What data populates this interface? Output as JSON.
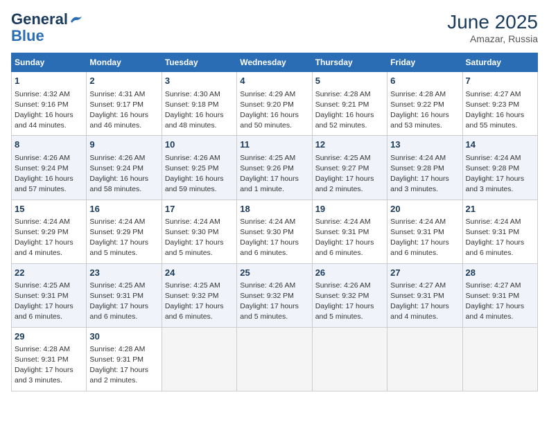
{
  "header": {
    "logo_line1": "General",
    "logo_line2": "Blue",
    "month_year": "June 2025",
    "location": "Amazar, Russia"
  },
  "days_of_week": [
    "Sunday",
    "Monday",
    "Tuesday",
    "Wednesday",
    "Thursday",
    "Friday",
    "Saturday"
  ],
  "weeks": [
    [
      {
        "day": "1",
        "sunrise": "4:32 AM",
        "sunset": "9:16 PM",
        "daylight": "16 hours and 44 minutes."
      },
      {
        "day": "2",
        "sunrise": "4:31 AM",
        "sunset": "9:17 PM",
        "daylight": "16 hours and 46 minutes."
      },
      {
        "day": "3",
        "sunrise": "4:30 AM",
        "sunset": "9:18 PM",
        "daylight": "16 hours and 48 minutes."
      },
      {
        "day": "4",
        "sunrise": "4:29 AM",
        "sunset": "9:20 PM",
        "daylight": "16 hours and 50 minutes."
      },
      {
        "day": "5",
        "sunrise": "4:28 AM",
        "sunset": "9:21 PM",
        "daylight": "16 hours and 52 minutes."
      },
      {
        "day": "6",
        "sunrise": "4:28 AM",
        "sunset": "9:22 PM",
        "daylight": "16 hours and 53 minutes."
      },
      {
        "day": "7",
        "sunrise": "4:27 AM",
        "sunset": "9:23 PM",
        "daylight": "16 hours and 55 minutes."
      }
    ],
    [
      {
        "day": "8",
        "sunrise": "4:26 AM",
        "sunset": "9:24 PM",
        "daylight": "16 hours and 57 minutes."
      },
      {
        "day": "9",
        "sunrise": "4:26 AM",
        "sunset": "9:24 PM",
        "daylight": "16 hours and 58 minutes."
      },
      {
        "day": "10",
        "sunrise": "4:26 AM",
        "sunset": "9:25 PM",
        "daylight": "16 hours and 59 minutes."
      },
      {
        "day": "11",
        "sunrise": "4:25 AM",
        "sunset": "9:26 PM",
        "daylight": "17 hours and 1 minute."
      },
      {
        "day": "12",
        "sunrise": "4:25 AM",
        "sunset": "9:27 PM",
        "daylight": "17 hours and 2 minutes."
      },
      {
        "day": "13",
        "sunrise": "4:24 AM",
        "sunset": "9:28 PM",
        "daylight": "17 hours and 3 minutes."
      },
      {
        "day": "14",
        "sunrise": "4:24 AM",
        "sunset": "9:28 PM",
        "daylight": "17 hours and 3 minutes."
      }
    ],
    [
      {
        "day": "15",
        "sunrise": "4:24 AM",
        "sunset": "9:29 PM",
        "daylight": "17 hours and 4 minutes."
      },
      {
        "day": "16",
        "sunrise": "4:24 AM",
        "sunset": "9:29 PM",
        "daylight": "17 hours and 5 minutes."
      },
      {
        "day": "17",
        "sunrise": "4:24 AM",
        "sunset": "9:30 PM",
        "daylight": "17 hours and 5 minutes."
      },
      {
        "day": "18",
        "sunrise": "4:24 AM",
        "sunset": "9:30 PM",
        "daylight": "17 hours and 6 minutes."
      },
      {
        "day": "19",
        "sunrise": "4:24 AM",
        "sunset": "9:31 PM",
        "daylight": "17 hours and 6 minutes."
      },
      {
        "day": "20",
        "sunrise": "4:24 AM",
        "sunset": "9:31 PM",
        "daylight": "17 hours and 6 minutes."
      },
      {
        "day": "21",
        "sunrise": "4:24 AM",
        "sunset": "9:31 PM",
        "daylight": "17 hours and 6 minutes."
      }
    ],
    [
      {
        "day": "22",
        "sunrise": "4:25 AM",
        "sunset": "9:31 PM",
        "daylight": "17 hours and 6 minutes."
      },
      {
        "day": "23",
        "sunrise": "4:25 AM",
        "sunset": "9:31 PM",
        "daylight": "17 hours and 6 minutes."
      },
      {
        "day": "24",
        "sunrise": "4:25 AM",
        "sunset": "9:32 PM",
        "daylight": "17 hours and 6 minutes."
      },
      {
        "day": "25",
        "sunrise": "4:26 AM",
        "sunset": "9:32 PM",
        "daylight": "17 hours and 5 minutes."
      },
      {
        "day": "26",
        "sunrise": "4:26 AM",
        "sunset": "9:32 PM",
        "daylight": "17 hours and 5 minutes."
      },
      {
        "day": "27",
        "sunrise": "4:27 AM",
        "sunset": "9:31 PM",
        "daylight": "17 hours and 4 minutes."
      },
      {
        "day": "28",
        "sunrise": "4:27 AM",
        "sunset": "9:31 PM",
        "daylight": "17 hours and 4 minutes."
      }
    ],
    [
      {
        "day": "29",
        "sunrise": "4:28 AM",
        "sunset": "9:31 PM",
        "daylight": "17 hours and 3 minutes."
      },
      {
        "day": "30",
        "sunrise": "4:28 AM",
        "sunset": "9:31 PM",
        "daylight": "17 hours and 2 minutes."
      },
      null,
      null,
      null,
      null,
      null
    ]
  ]
}
